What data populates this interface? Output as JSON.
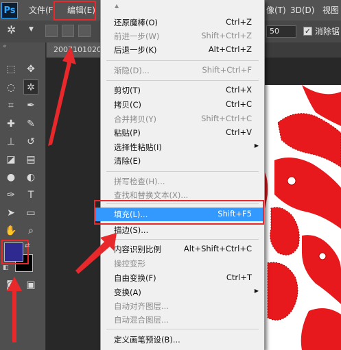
{
  "app": {
    "logo": "Ps"
  },
  "menubar": {
    "file": "文件(F",
    "edit": "编辑(E)",
    "image_partial": "像(T)",
    "view3d": "3D(D)",
    "view": "视图"
  },
  "options": {
    "tolerance": "50",
    "antialias_label": "消除锯",
    "antialias_checked": "✓"
  },
  "document": {
    "tab": "2007101020"
  },
  "colors": {
    "foreground": "#2e2a8f",
    "background": "#000000",
    "highlight": "#e8282b",
    "menu_selected": "#3399ff"
  },
  "editmenu": {
    "undo": "还原魔棒(O)",
    "undo_sc": "Ctrl+Z",
    "step_fwd": "前进一步(W)",
    "step_fwd_sc": "Shift+Ctrl+Z",
    "step_back": "后退一步(K)",
    "step_back_sc": "Alt+Ctrl+Z",
    "fade": "渐隐(D)...",
    "fade_sc": "Shift+Ctrl+F",
    "cut": "剪切(T)",
    "cut_sc": "Ctrl+X",
    "copy": "拷贝(C)",
    "copy_sc": "Ctrl+C",
    "copy_merged": "合并拷贝(Y)",
    "copy_merged_sc": "Shift+Ctrl+C",
    "paste": "粘贴(P)",
    "paste_sc": "Ctrl+V",
    "paste_special": "选择性粘贴(I)",
    "clear": "清除(E)",
    "spell_check": "拼写检查(H)...",
    "find_replace": "查找和替换文本(X)...",
    "fill": "填充(L)...",
    "fill_sc": "Shift+F5",
    "stroke": "描边(S)...",
    "content_aware_scale": "内容识别比例",
    "content_aware_scale_sc": "Alt+Shift+Ctrl+C",
    "puppet_warp": "操控变形",
    "free_transform": "自由变换(F)",
    "free_transform_sc": "Ctrl+T",
    "transform": "变换(A)",
    "auto_align": "自动对齐图层...",
    "auto_blend": "自动混合图层...",
    "define_brush": "定义画笔预设(B)..."
  }
}
